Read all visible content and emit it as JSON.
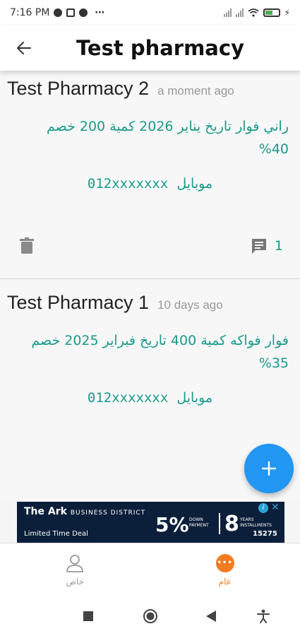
{
  "status_bar": {
    "time": "7:16 PM",
    "dots": "⋯"
  },
  "app_bar": {
    "title": "Test pharmacy"
  },
  "posts": [
    {
      "author": "Test Pharmacy 2",
      "time_ago": "a moment ago",
      "body": "راني فوار تاريخ يناير 2026 كمية 200 خصم 40%",
      "phone_label": "موبايل",
      "phone": "012xxxxxxx",
      "comment_count": "1"
    },
    {
      "author": "Test Pharmacy 1",
      "time_ago": "10 days ago",
      "body": "فوار فواكه كمية 400 تاريخ فبراير 2025 خصم 35%",
      "phone_label": "موبايل",
      "phone": "012xxxxxxx"
    }
  ],
  "ad": {
    "brand": "The Ark",
    "brand_sub": "BUSINESS DISTRICT",
    "deal": "Limited Time Deal",
    "percent": "5%",
    "percent_sub": "DOWN PAYMENT",
    "years": "8",
    "years_sub": "YEARS INSTALLMENTS",
    "code": "15275",
    "info": "i",
    "close": "✕"
  },
  "bottom_nav": {
    "private_label": "خاص",
    "public_label": "عام",
    "active_color": "#f47c20"
  },
  "colors": {
    "accent_teal": "#189a8a",
    "fab_blue": "#2196f3"
  },
  "icons": [
    "back-arrow-icon",
    "trash-icon",
    "comment-icon",
    "plus-icon",
    "person-icon",
    "chat-icon",
    "stop-square-icon",
    "home-circle-icon",
    "back-triangle-icon",
    "accessibility-icon"
  ]
}
